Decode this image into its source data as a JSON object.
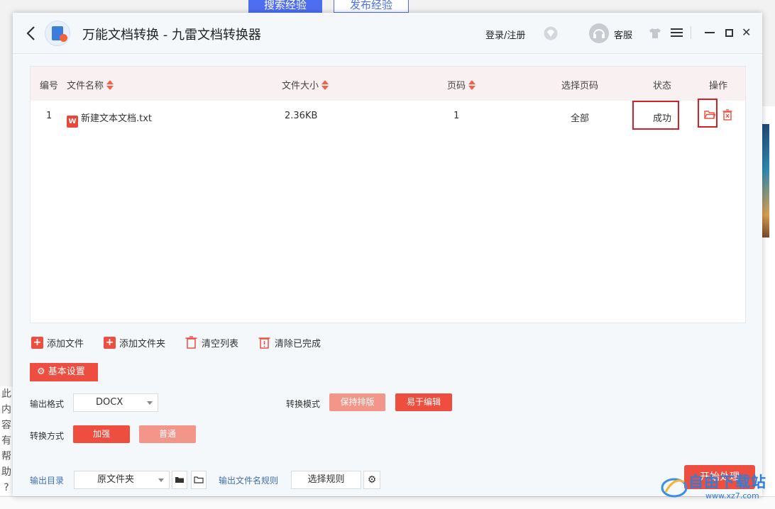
{
  "background": {
    "tab_search": "搜索经验",
    "tab_publish": "发布经验",
    "side_text": [
      "此",
      "内",
      "容",
      "有",
      "帮",
      "助",
      "?"
    ]
  },
  "titlebar": {
    "title": "万能文档转换 - 九雷文档转换器",
    "login": "登录/注册",
    "service": "客服"
  },
  "table": {
    "headers": {
      "index": "编号",
      "name": "文件名称",
      "size": "文件大小",
      "pages": "页码",
      "select_pages": "选择页码",
      "status": "状态",
      "action": "操作"
    },
    "rows": [
      {
        "index": "1",
        "name": "新建文本文档.txt",
        "size": "2.36KB",
        "pages": "1",
        "select_pages": "全部",
        "status": "成功"
      }
    ]
  },
  "toolbar": {
    "add_file": "添加文件",
    "add_folder": "添加文件夹",
    "clear_list": "清空列表",
    "clear_done": "清除已完成"
  },
  "settings": {
    "basic_settings": "基本设置",
    "output_format_label": "输出格式",
    "output_format_value": "DOCX",
    "convert_mode_label": "转换模式",
    "mode_keep_layout": "保持排版",
    "mode_easy_edit": "易于编辑",
    "convert_method_label": "转换方式",
    "method_enhanced": "加强",
    "method_normal": "普通",
    "output_dir_label": "输出目录",
    "output_dir_value": "原文件夹",
    "filename_rule_label": "输出文件名规则",
    "choose_rule": "选择规则",
    "start": "开始处理"
  },
  "watermark": {
    "text": "自由下载站",
    "url": "www.xz7.com"
  },
  "colors": {
    "accent": "#ee4e3f",
    "accent_light": "#f4958a",
    "highlight_box": "#d0202a",
    "header_bg": "#f9f1f1"
  }
}
